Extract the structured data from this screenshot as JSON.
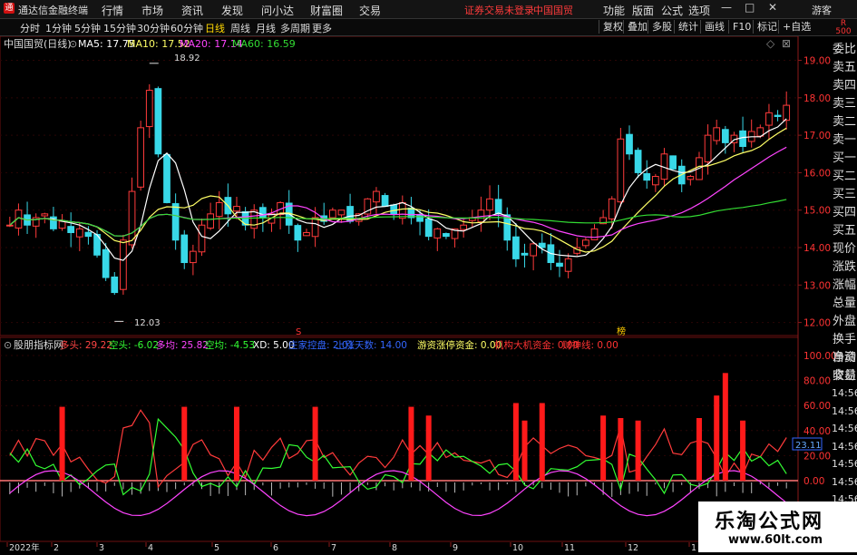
{
  "app": {
    "title": "通达信金融终端",
    "logo": "通"
  },
  "menu": [
    "行情",
    "市场",
    "资讯",
    "发现",
    "问小达",
    "财富圈",
    "交易"
  ],
  "notice": {
    "login": "证券交易未登录",
    "stock": "中国国贸"
  },
  "right_menu": [
    "功能",
    "版面",
    "公式",
    "选项"
  ],
  "guest": "游客",
  "window_controls": [
    "—",
    "□",
    "✕"
  ],
  "periods": [
    "分时",
    "1分钟",
    "5分钟",
    "15分钟",
    "30分钟",
    "60分钟",
    "日线",
    "周线",
    "月线",
    "多周期",
    "更多"
  ],
  "active_period": "日线",
  "tools": [
    "复权",
    "叠加",
    "多股",
    "统计",
    "画线",
    "F10",
    "标记",
    "+自选"
  ],
  "r_badge": {
    "r": "R",
    "n": "500"
  },
  "stock_label": "中国国贸(日线)",
  "ma": [
    {
      "label": "MA5: 17.75",
      "color": "#ffffff"
    },
    {
      "label": "MA10: 17.52",
      "color": "#ffff66"
    },
    {
      "label": "MA20: 17.14",
      "color": "#ff44ff"
    },
    {
      "label": "MA60: 16.59",
      "color": "#33dd33"
    }
  ],
  "price_high_label": "18.92",
  "price_low_label": "12.03",
  "price_axis": [
    "19.00",
    "18.00",
    "17.00",
    "16.00",
    "15.00",
    "14.00",
    "13.00",
    "12.00"
  ],
  "price_axis_color": "#ff3333",
  "right_panel": [
    "委比",
    "卖五",
    "卖四",
    "卖三",
    "卖二",
    "卖一",
    "买一",
    "买二",
    "买三",
    "买四",
    "买五",
    "现价",
    "涨跌",
    "涨幅",
    "总量",
    "外盘",
    "换手",
    "净资",
    "收益"
  ],
  "right_panel_lower": [
    "自动",
    "交易"
  ],
  "side_times": [
    "14:56",
    "14:56",
    "14:56",
    "14:56",
    "14:56",
    "14:56",
    "14:56"
  ],
  "indicator": {
    "name": "股朋指标网",
    "items": [
      {
        "text": "多头: 29.22",
        "color": "#ff4444"
      },
      {
        "text": "空头: -6.02",
        "color": "#33ff33"
      },
      {
        "text": "多均: 25.82",
        "color": "#ff44ff"
      },
      {
        "text": "空均: -4.53",
        "color": "#33ff33"
      },
      {
        "text": "XD: 5.00",
        "color": "#ffffff"
      },
      {
        "text": "庄家控盘: 2.01",
        "color": "#3366ff"
      },
      {
        "text": "上涨天数: 14.00",
        "color": "#3366ff"
      },
      {
        "text": "游资涨停资金: 0.00",
        "color": "#ffff66"
      },
      {
        "text": "机构大机资金: 0.00",
        "color": "#ff3333"
      },
      {
        "text": "财神线: 0.00",
        "color": "#ff3333"
      }
    ]
  },
  "ind_axis": [
    "100.00",
    "80.00",
    "60.00",
    "40.00",
    "20.00",
    "0.00"
  ],
  "ind_badge": "23.11",
  "markers": {
    "s": "S",
    "b": "榜"
  },
  "date_axis": [
    "2022年",
    "2",
    "3",
    "4",
    "5",
    "6",
    "7",
    "8",
    "9",
    "10",
    "11",
    "12",
    "1"
  ],
  "watermark": {
    "title": "乐淘公式网",
    "url": "www.60lt.com"
  },
  "chart_data": {
    "type": "candlestick",
    "title": "中国国贸(日线)",
    "ylim": [
      11.7,
      19.4
    ],
    "ma_latest": {
      "MA5": 17.75,
      "MA10": 17.52,
      "MA20": 17.14,
      "MA60": 16.59
    },
    "high": 18.92,
    "low": 12.03,
    "close_series": [
      14.6,
      15.0,
      14.6,
      14.8,
      14.9,
      14.5,
      14.7,
      14.4,
      14.5,
      14.3,
      13.8,
      13.2,
      12.8,
      14.2,
      15.5,
      17.2,
      18.2,
      16.5,
      15.2,
      14.2,
      13.6,
      13.9,
      14.6,
      14.9,
      15.2,
      14.9,
      15.1,
      14.6,
      15.0,
      14.8,
      14.9,
      15.2,
      14.6,
      14.2,
      14.4,
      14.8,
      14.7,
      15.0,
      15.0,
      14.7,
      14.9,
      15.3,
      15.5,
      15.1,
      14.9,
      15.2,
      14.8,
      14.7,
      14.3,
      14.5,
      14.3,
      14.5,
      14.6,
      14.8,
      15.0,
      15.3,
      14.9,
      14.2,
      13.7,
      13.8,
      14.1,
      14.0,
      13.6,
      13.5,
      13.7,
      14.0,
      14.2,
      14.5,
      14.8,
      15.3,
      16.9,
      16.5,
      16.0,
      15.8,
      15.9,
      16.5,
      16.1,
      15.7,
      15.9,
      16.4,
      17.0,
      17.2,
      16.8,
      17.0,
      16.7,
      17.1,
      17.2,
      17.6,
      17.5,
      17.8
    ],
    "volume_bars": [
      0,
      0,
      0,
      0,
      0,
      0,
      0,
      0,
      0,
      0,
      0,
      0,
      0,
      0,
      0,
      0,
      0,
      0,
      0,
      0,
      0,
      0,
      0,
      0,
      0,
      0,
      0,
      0,
      0,
      0,
      0,
      0,
      0,
      0,
      0,
      0,
      0,
      0,
      0,
      0,
      0,
      0,
      0,
      0,
      0,
      0,
      0,
      0,
      0,
      0,
      0,
      0,
      0,
      0,
      0,
      0,
      0,
      0,
      0,
      0,
      0,
      0,
      0,
      0,
      0,
      0,
      0,
      0,
      0,
      0,
      0,
      0,
      0,
      0,
      0,
      0,
      0,
      0,
      0,
      0,
      0,
      0,
      0,
      0,
      0,
      0,
      0,
      0,
      0,
      0
    ],
    "signal_bars": [
      {
        "x": 6,
        "v": 59
      },
      {
        "x": 20,
        "v": 59
      },
      {
        "x": 26,
        "v": 59
      },
      {
        "x": 35,
        "v": 59
      },
      {
        "x": 46,
        "v": 59
      },
      {
        "x": 48,
        "v": 52
      },
      {
        "x": 58,
        "v": 62
      },
      {
        "x": 59,
        "v": 48
      },
      {
        "x": 61,
        "v": 62
      },
      {
        "x": 68,
        "v": 52
      },
      {
        "x": 70,
        "v": 50
      },
      {
        "x": 72,
        "v": 48
      },
      {
        "x": 79,
        "v": 50
      },
      {
        "x": 81,
        "v": 68
      },
      {
        "x": 82,
        "v": 86
      },
      {
        "x": 84,
        "v": 48
      }
    ]
  }
}
